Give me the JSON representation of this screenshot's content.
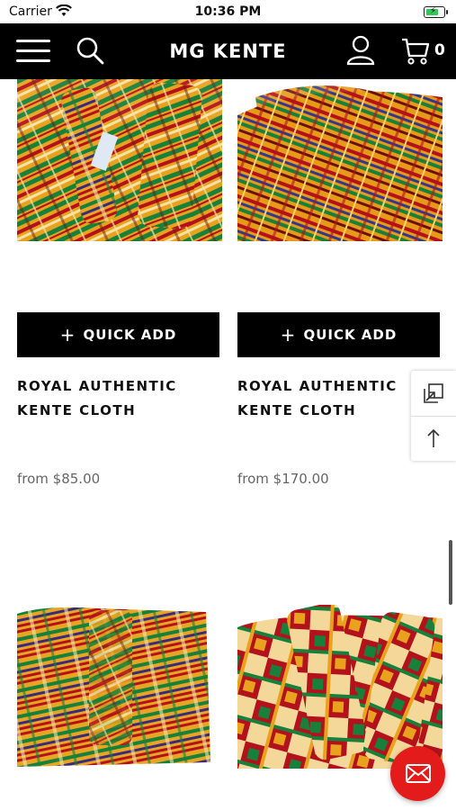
{
  "status_bar": {
    "carrier": "Carrier",
    "time": "10:36 PM",
    "battery_level": 0.8
  },
  "header": {
    "brand": "MG KENTE",
    "cart_count": "0"
  },
  "colors": {
    "header_bg": "#000000",
    "fab": "#e31b1b",
    "kente_gold": "#e9a21e",
    "kente_green": "#17803a",
    "kente_red": "#b3121c"
  },
  "products": [
    {
      "quick_add_label": "QUICK ADD",
      "title": "ROYAL AUTHENTIC KENTE CLOTH",
      "price": "from $85.00"
    },
    {
      "quick_add_label": "QUICK ADD",
      "title": "ROYAL AUTHENTIC KENTE CLOTH",
      "price": "from $170.00"
    }
  ],
  "icons": [
    "menu-icon",
    "search-icon",
    "account-icon",
    "cart-icon",
    "expand-icon",
    "arrow-up-icon",
    "mail-icon"
  ]
}
